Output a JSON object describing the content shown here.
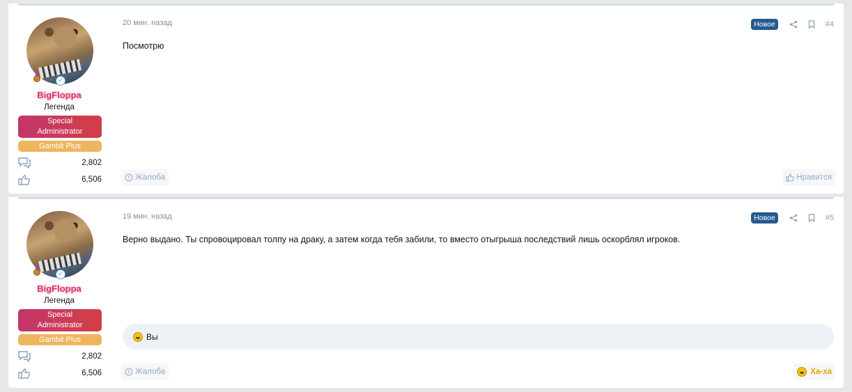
{
  "posts": [
    {
      "user": {
        "name": "BigFloppa",
        "title": "Легенда",
        "banner_primary": "Special Administrator",
        "banner_secondary": "Gambit Plus",
        "messages_count": "2,802",
        "reactions_count": "6,506"
      },
      "date": "20 мин. назад",
      "new_badge": "Новое",
      "post_number": "#4",
      "message": "Посмотрю",
      "report_label": "Жалоба",
      "like_label": "Нравится"
    },
    {
      "user": {
        "name": "BigFloppa",
        "title": "Легенда",
        "banner_primary": "Special Administrator",
        "banner_secondary": "Gambit Plus",
        "messages_count": "2,802",
        "reactions_count": "6,506"
      },
      "date": "19 мин. назад",
      "new_badge": "Новое",
      "post_number": "#5",
      "message": "Верно выдано. Ты спровоцировал толпу на драку, а затем когда тебя забили, то вместо отыгрыша последствий лишь оскорблял игроков.",
      "reactions_by": "Вы",
      "report_label": "Жалоба",
      "reaction_label": "Ха-ха"
    }
  ],
  "colors": {
    "username": "#d4356b",
    "new_badge_bg": "#245b8f",
    "admin_banner": "#c4356b",
    "plus_banner": "#eeb55f"
  }
}
